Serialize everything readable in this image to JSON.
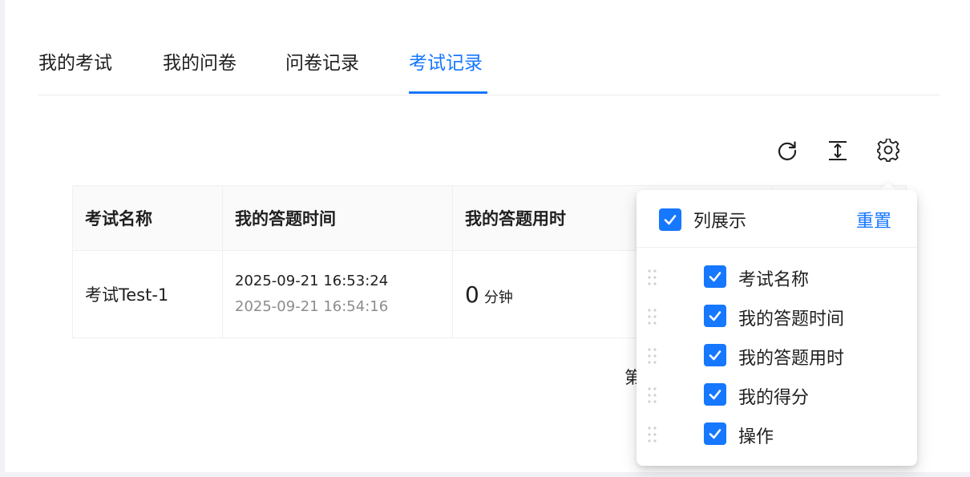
{
  "tabs": [
    {
      "label": "我的考试",
      "active": false
    },
    {
      "label": "我的问卷",
      "active": false
    },
    {
      "label": "问卷记录",
      "active": false
    },
    {
      "label": "考试记录",
      "active": true
    }
  ],
  "toolbar": {
    "icons": [
      "reload-icon",
      "column-height-icon",
      "setting-icon"
    ]
  },
  "table": {
    "columns": [
      "考试名称",
      "我的答题时间",
      "我的答题用时"
    ],
    "rows": [
      {
        "name": "考试Test-1",
        "start_time": "2025-09-21 16:53:24",
        "end_time": "2025-09-21 16:54:16",
        "duration_value": "0",
        "duration_unit": "分钟"
      }
    ]
  },
  "pagination": {
    "partial_text": "第"
  },
  "column_settings": {
    "title": "列展示",
    "reset_label": "重置",
    "all_checked": true,
    "items": [
      {
        "label": "考试名称",
        "checked": true
      },
      {
        "label": "我的答题时间",
        "checked": true
      },
      {
        "label": "我的答题用时",
        "checked": true
      },
      {
        "label": "我的得分",
        "checked": true
      },
      {
        "label": "操作",
        "checked": true
      }
    ]
  },
  "colors": {
    "accent": "#1677ff",
    "text": "#1f1f1f",
    "muted_text": "#8c8c8c",
    "header_bg": "#fafafa"
  }
}
